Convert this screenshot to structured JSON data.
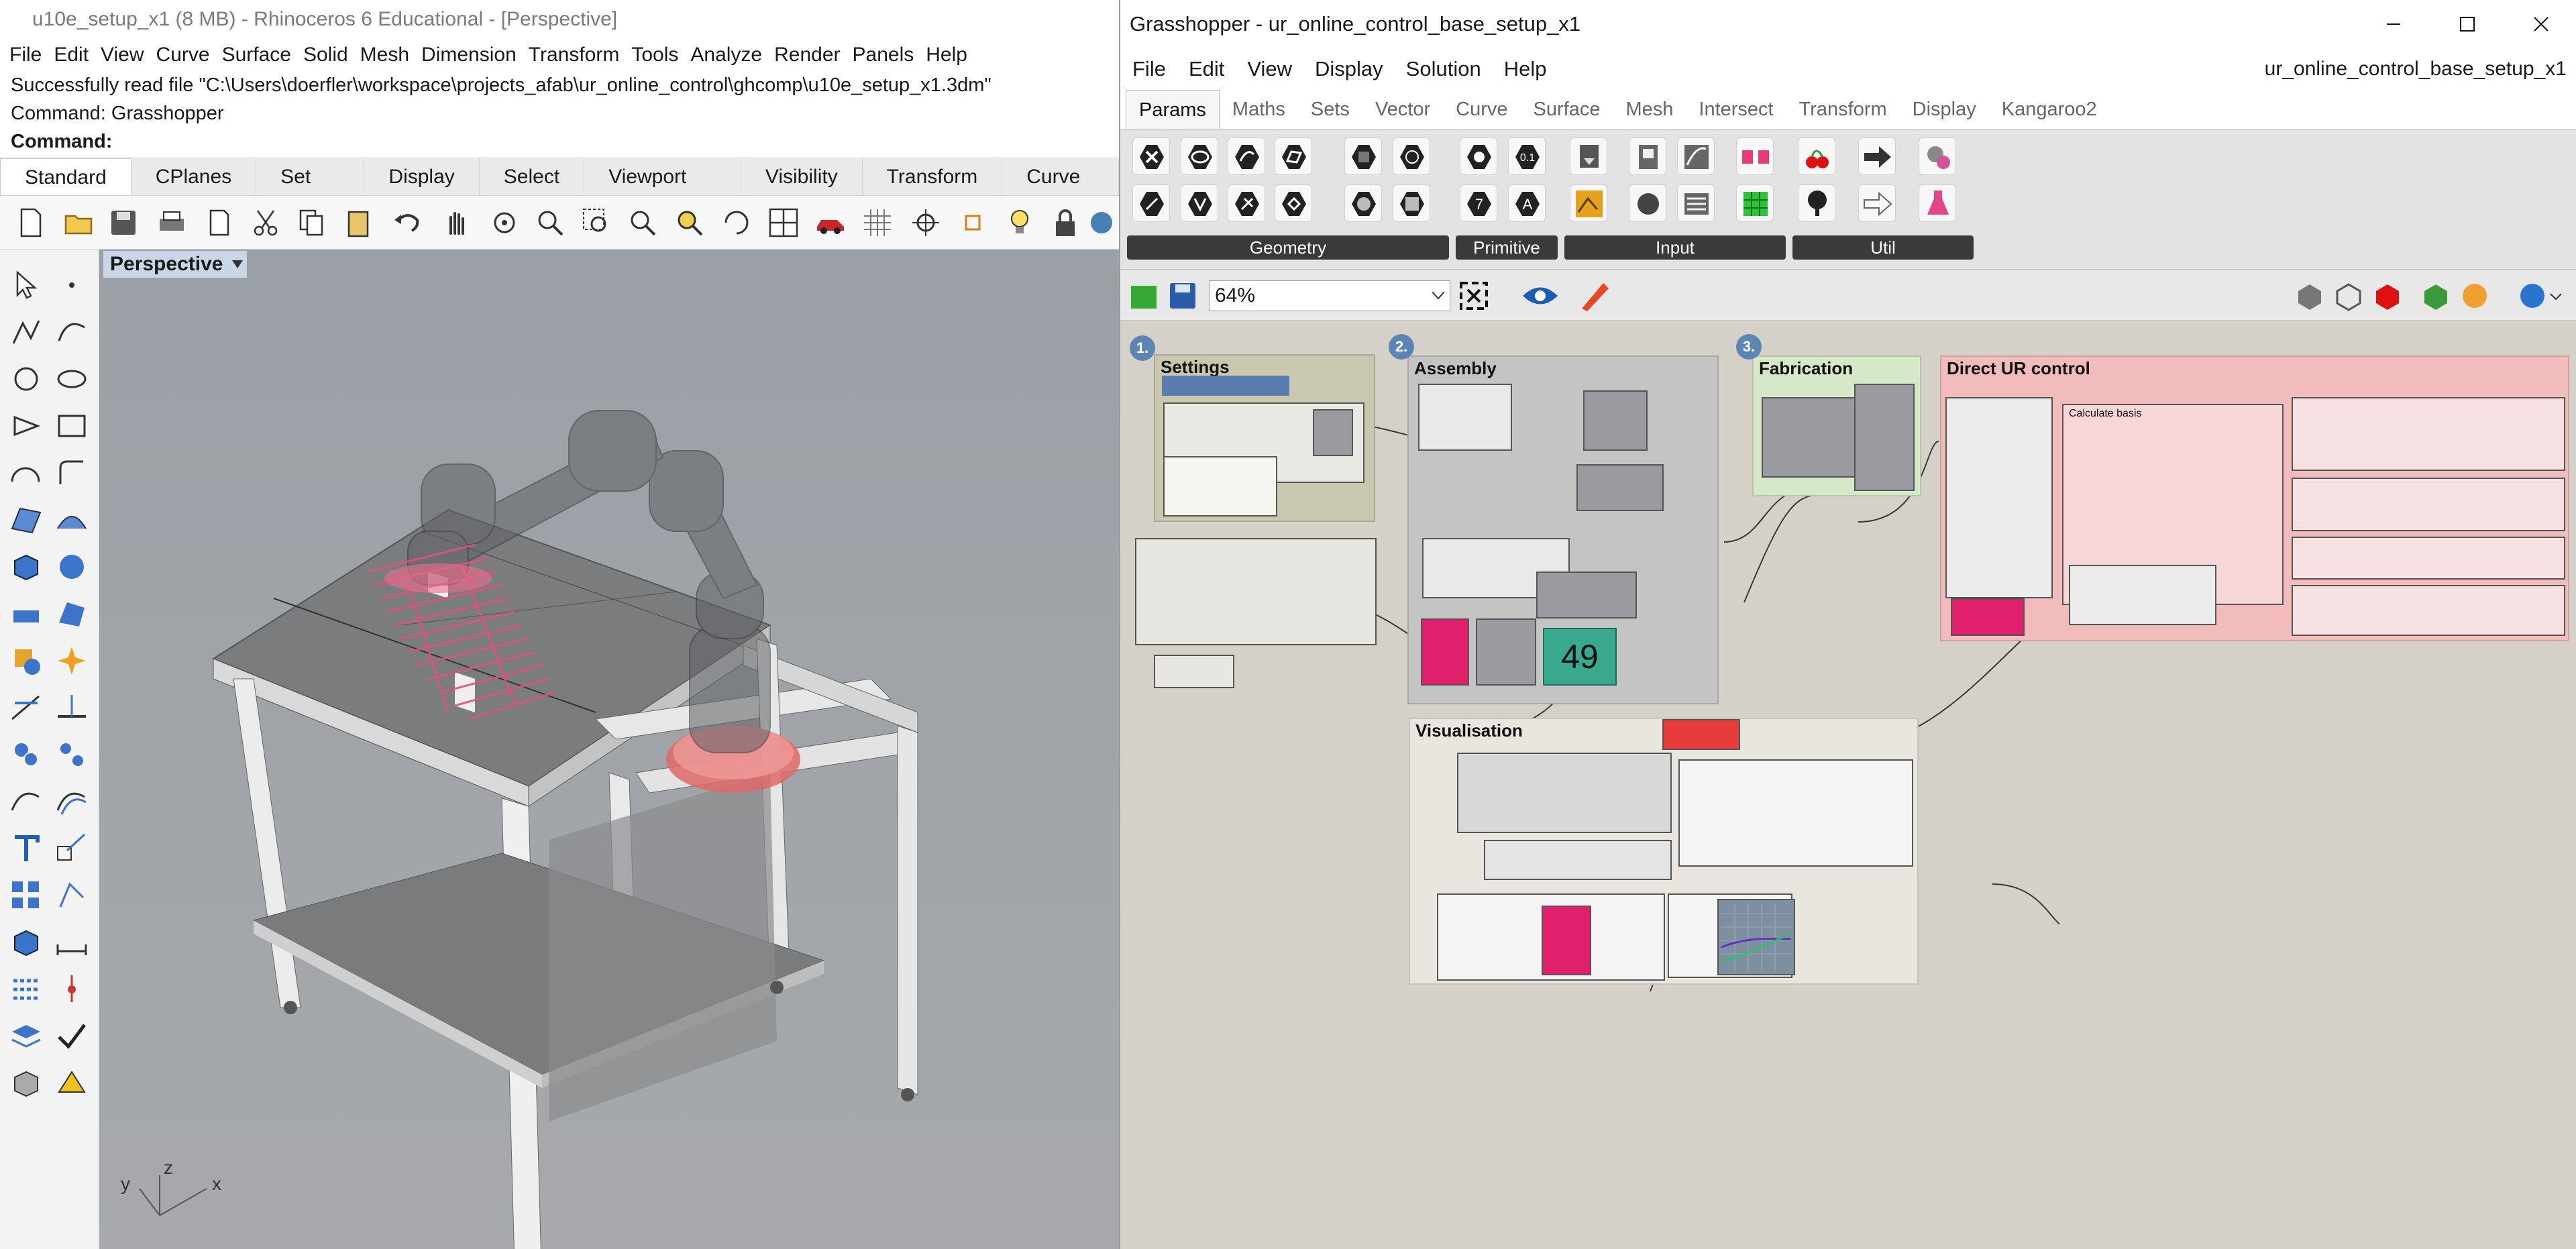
{
  "rhino": {
    "title": "u10e_setup_x1 (8 MB) - Rhinoceros 6 Educational - [Perspective]",
    "menu": [
      "File",
      "Edit",
      "View",
      "Curve",
      "Surface",
      "Solid",
      "Mesh",
      "Dimension",
      "Transform",
      "Tools",
      "Analyze",
      "Render",
      "Panels",
      "Help"
    ],
    "command_history": [
      "Successfully read file \"C:\\Users\\doerfler\\workspace\\projects_afab\\ur_online_control\\ghcomp\\u10e_setup_x1.3dm\"",
      "Command: Grasshopper"
    ],
    "command_prompt": "Command:",
    "toolbar_tabs": [
      "Standard",
      "CPlanes",
      "Set View",
      "Display",
      "Select",
      "Viewport Layout",
      "Visibility",
      "Transform",
      "Curve Toc"
    ],
    "active_tab": "Standard",
    "toolbar_icons": [
      "new-icon",
      "open-icon",
      "save-icon",
      "print-icon",
      "import-icon",
      "cut-icon",
      "copy-icon",
      "paste-icon",
      "undo-icon",
      "pan-icon",
      "rotate-icon",
      "zoom-icon",
      "zoom-window-icon",
      "zoom-extents-icon",
      "zoom-selected-icon",
      "rotate-view-icon",
      "four-view-icon",
      "car-icon",
      "grid-icon",
      "snap-icon",
      "osnap-icon",
      "light-icon",
      "lock-icon",
      "render-icon"
    ],
    "viewport_label": "Perspective",
    "axis_labels": {
      "x": "x",
      "y": "y",
      "z": "z"
    }
  },
  "grasshopper": {
    "title": "Grasshopper - ur_online_control_base_setup_x1",
    "menu": [
      "File",
      "Edit",
      "View",
      "Display",
      "Solution",
      "Help"
    ],
    "document_name": "ur_online_control_base_setup_x1",
    "tabs": [
      "Params",
      "Maths",
      "Sets",
      "Vector",
      "Curve",
      "Surface",
      "Mesh",
      "Intersect",
      "Transform",
      "Display",
      "Kangaroo2"
    ],
    "active_tab": "Params",
    "ribbon_groups": [
      "Geometry",
      "Primitive",
      "Input",
      "Util"
    ],
    "primitive_icon_labels": [
      "0.1",
      "7",
      "A"
    ],
    "zoom": "64%",
    "canvas": {
      "groups": [
        {
          "badge": "1.",
          "title": "Settings"
        },
        {
          "badge": "2.",
          "title": "Assembly"
        },
        {
          "badge": "3.",
          "title": "Fabrication"
        },
        {
          "title": "Direct UR control"
        },
        {
          "title": "Visualisation"
        }
      ],
      "subgroup": "Calculate basis",
      "number_slider_value": "49"
    }
  },
  "colors": {
    "gh_settings_group": "#c9c7b0",
    "gh_assembly_group": "#c4c4c4",
    "gh_fabrication_group": "#d5e8c8",
    "gh_direct_group": "#f2bcbc",
    "gh_visualisation_group": "#e9e6e0",
    "rhino_viewport": "#9fa2a6",
    "highlight_pink": "#e0206c",
    "panel_teal": "#3aa88c"
  }
}
